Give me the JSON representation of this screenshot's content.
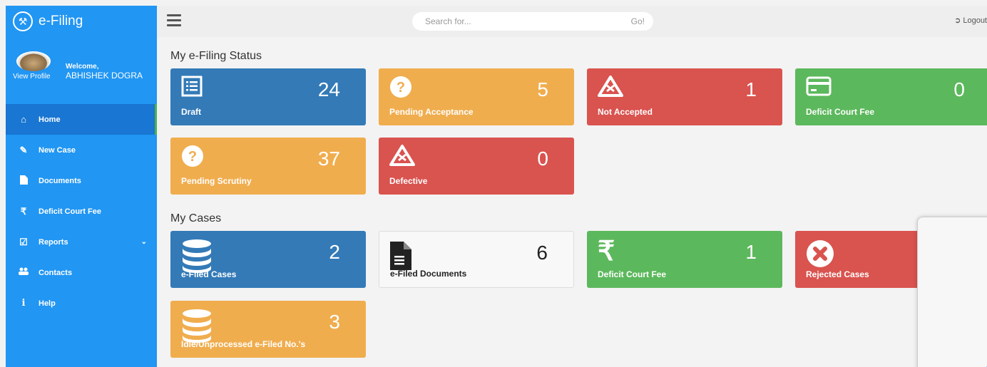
{
  "app": {
    "title": "e-Filing"
  },
  "profile": {
    "welcome": "Welcome,",
    "view_profile": "View Profile",
    "name": "ABHISHEK DOGRA"
  },
  "sidebar": {
    "items": [
      {
        "label": "Home",
        "icon": "home-icon"
      },
      {
        "label": "New Case",
        "icon": "edit-icon"
      },
      {
        "label": "Documents",
        "icon": "file-icon"
      },
      {
        "label": "Deficit Court Fee",
        "icon": "rupee-icon"
      },
      {
        "label": "Reports",
        "icon": "reports-icon"
      },
      {
        "label": "Contacts",
        "icon": "users-icon"
      },
      {
        "label": "Help",
        "icon": "info-icon"
      }
    ]
  },
  "topbar": {
    "search_placeholder": "Search for...",
    "go_label": "Go!",
    "logout_label": "Logout"
  },
  "status": {
    "title": "My e-Filing Status",
    "tiles": [
      {
        "value": "24",
        "label": "Draft",
        "color": "#337ab7",
        "icon": "list-icon"
      },
      {
        "value": "5",
        "label": "Pending Acceptance",
        "color": "#f0ad4e",
        "icon": "question-icon"
      },
      {
        "value": "1",
        "label": "Not Accepted",
        "color": "#d9534f",
        "icon": "warning-icon"
      },
      {
        "value": "0",
        "label": "Deficit Court Fee",
        "color": "#5cb85c",
        "icon": "card-icon"
      },
      {
        "value": "37",
        "label": "Pending Scrutiny",
        "color": "#f0ad4e",
        "icon": "question-icon"
      },
      {
        "value": "0",
        "label": "Defective",
        "color": "#d9534f",
        "icon": "warning-icon"
      }
    ]
  },
  "cases": {
    "title": "My Cases",
    "tiles": [
      {
        "value": "2",
        "label": "e-Filed Cases",
        "color": "#337ab7",
        "icon": "database-icon"
      },
      {
        "value": "6",
        "label": "e-Filed Documents",
        "color": "#f8f8f8",
        "icon": "document-icon"
      },
      {
        "value": "1",
        "label": "Deficit Court Fee",
        "color": "#5cb85c",
        "icon": "rupee-icon"
      },
      {
        "value": "",
        "label": "Rejected Cases",
        "color": "#d9534f",
        "icon": "close-circle-icon"
      },
      {
        "value": "3",
        "label": "Idle/Unprocessed e-Filed No.'s",
        "color": "#f0ad4e",
        "icon": "database-icon"
      }
    ]
  }
}
